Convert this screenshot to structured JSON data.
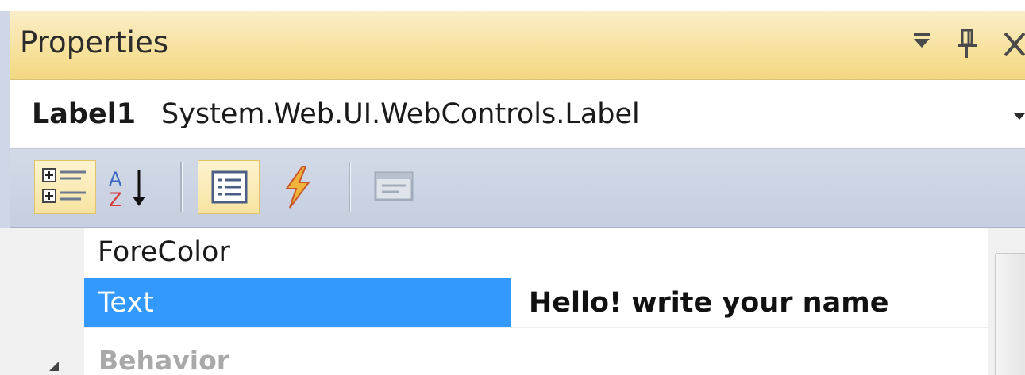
{
  "window": {
    "title": "Properties",
    "icons": [
      "dropdown-arrow-icon",
      "pin-icon",
      "close-icon"
    ]
  },
  "selector": {
    "object_name": "Label1",
    "object_type": "System.Web.UI.WebControls.Label"
  },
  "toolbar": {
    "buttons": [
      {
        "name": "categorized-icon",
        "active": true
      },
      {
        "name": "alphabetical-icon",
        "active": false
      },
      {
        "name": "properties-icon",
        "active": true
      },
      {
        "name": "events-icon",
        "active": false
      },
      {
        "name": "property-pages-icon",
        "active": false
      }
    ]
  },
  "grid": {
    "rows": [
      {
        "name": "ForeColor",
        "value": ""
      },
      {
        "name": "Text",
        "value": "Hello! write your name",
        "selected": true
      }
    ],
    "category": "Behavior"
  },
  "colors": {
    "titlebar": "#f7e19b",
    "selection": "#3399ff",
    "toolbar": "#c6cedf"
  }
}
